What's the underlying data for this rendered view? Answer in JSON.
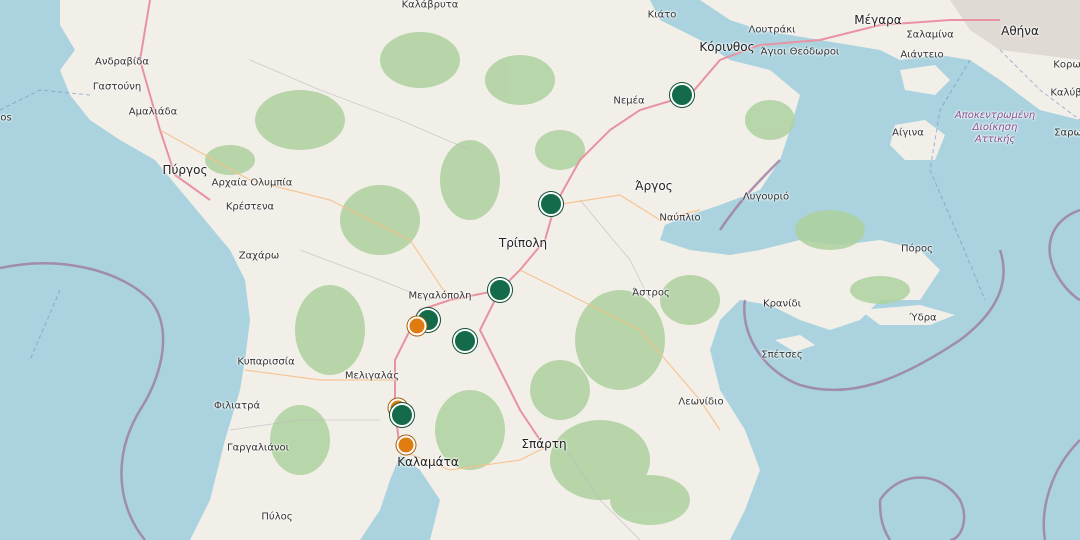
{
  "map": {
    "colors": {
      "sea": "#aad3df",
      "land": "#f2efe9",
      "forest": "#add19e",
      "road_primary": "#e892a2",
      "boundary": "#9e7ba0"
    },
    "labels": {
      "kalavryta": "Καλάβρυτα",
      "kiato": "Κιάτο",
      "loutraki": "Λουτράκι",
      "megara": "Μέγαρα",
      "athina": "Αθήνα",
      "salamina": "Σαλαμίνα",
      "aianteio": "Αιάντειο",
      "korinthos": "Κόρινθος",
      "agioi_theodoroi": "Άγιοι Θεόδωροι",
      "koro": "Κορω",
      "kalyv": "Καλύβ",
      "andravida": "Ανδραβίδα",
      "gastouni": "Γαστούνη",
      "amaliada": "Αμαλιάδα",
      "nemea": "Νεμέα",
      "region_line1": "Αποκεντρωμένη",
      "region_line2": "Διοίκηση",
      "region_line3": "Αττικής",
      "aigina": "Αίγινα",
      "saro": "Σαρω",
      "pyrgos": "Πύργος",
      "archaia_olympia": "Αρχαία Ολυμπία",
      "argos": "Άργος",
      "krestena": "Κρέστενα",
      "nafplio": "Ναύπλιο",
      "lygourio": "Λυγουριό",
      "tripoli": "Τρίπολη",
      "poros": "Πόρος",
      "zacharo": "Ζαχάρω",
      "megalopoli": "Μεγαλόπολη",
      "astros": "Άστρος",
      "kranidi": "Κρανίδι",
      "ydra": "Ύδρα",
      "spetses": "Σπέτσες",
      "kyparissia": "Κυπαρισσία",
      "meligalas": "Μελιγαλάς",
      "leonidio": "Λεωνίδιο",
      "filiatra": "Φιλιατρά",
      "sparti": "Σπάρτη",
      "gargalianoi": "Γαργαλιάνοι",
      "kalamata": "Καλαμάτα",
      "pylos": "Πύλος",
      "os": "οs"
    },
    "markers": [
      {
        "id": "m1",
        "color": "green"
      },
      {
        "id": "m2",
        "color": "green"
      },
      {
        "id": "m3",
        "color": "green"
      },
      {
        "id": "m4",
        "color": "green"
      },
      {
        "id": "m5",
        "color": "green"
      },
      {
        "id": "m6",
        "color": "orange"
      },
      {
        "id": "m7",
        "color": "orange"
      },
      {
        "id": "m8",
        "color": "green"
      },
      {
        "id": "m9",
        "color": "orange"
      }
    ]
  }
}
